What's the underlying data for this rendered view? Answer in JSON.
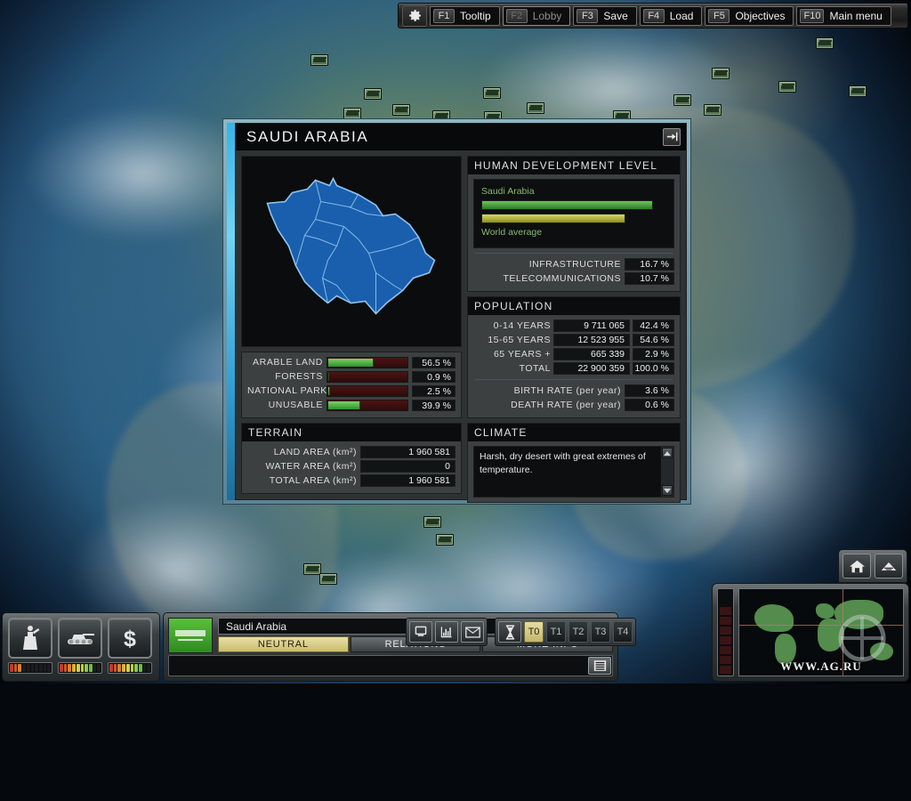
{
  "topbar": {
    "gear_icon": "gear-icon",
    "items": [
      {
        "key": "F1",
        "label": "Tooltip",
        "disabled": false
      },
      {
        "key": "F2",
        "label": "Lobby",
        "disabled": true
      },
      {
        "key": "F3",
        "label": "Save",
        "disabled": false
      },
      {
        "key": "F4",
        "label": "Load",
        "disabled": false
      },
      {
        "key": "F5",
        "label": "Objectives",
        "disabled": false
      },
      {
        "key": "F10",
        "label": "Main menu",
        "disabled": false
      }
    ]
  },
  "country_panel": {
    "title": "SAUDI ARABIA",
    "close_icon": "collapse-panel-icon",
    "land_use": {
      "rows": [
        {
          "label": "ARABLE LAND",
          "value": "56.5 %",
          "percent": 56.5
        },
        {
          "label": "FORESTS",
          "value": "0.9 %",
          "percent": 0.9
        },
        {
          "label": "NATIONAL PARKS",
          "value": "2.5 %",
          "percent": 2.5
        },
        {
          "label": "UNUSABLE",
          "value": "39.9 %",
          "percent": 39.9
        }
      ]
    },
    "terrain": {
      "title": "TERRAIN",
      "rows": [
        {
          "label": "LAND AREA (km²)",
          "value": "1 960 581"
        },
        {
          "label": "WATER AREA (km²)",
          "value": "0"
        },
        {
          "label": "TOTAL AREA (km²)",
          "value": "1 960 581"
        }
      ]
    },
    "hdl": {
      "title": "HUMAN DEVELOPMENT LEVEL",
      "country_label": "Saudi Arabia",
      "world_label": "World average",
      "country_percent": 93,
      "world_percent": 78,
      "stats": [
        {
          "label": "INFRASTRUCTURE",
          "value": "16.7 %"
        },
        {
          "label": "TELECOMMUNICATIONS",
          "value": "10.7 %"
        }
      ]
    },
    "population": {
      "title": "POPULATION",
      "rows": [
        {
          "label": "0-14 YEARS",
          "number": "9 711 065",
          "percent": "42.4 %"
        },
        {
          "label": "15-65 YEARS",
          "number": "12 523 955",
          "percent": "54.6 %"
        },
        {
          "label": "65 YEARS +",
          "number": "665 339",
          "percent": "2.9 %"
        },
        {
          "label": "TOTAL",
          "number": "22 900 359",
          "percent": "100.0 %"
        }
      ],
      "rates": [
        {
          "label": "BIRTH RATE (per year)",
          "value": "3.6 %"
        },
        {
          "label": "DEATH RATE (per year)",
          "value": "0.6 %"
        }
      ]
    },
    "climate": {
      "title": "CLIMATE",
      "text": "Harsh, dry desert with great extremes of temperature."
    }
  },
  "bottom_left": {
    "buttons": [
      {
        "name": "politics-button",
        "icon": "politician-podium-icon"
      },
      {
        "name": "military-button",
        "icon": "tank-icon"
      },
      {
        "name": "economy-button",
        "icon": "dollar-icon"
      }
    ],
    "meters": [
      {
        "name": "politics-meter",
        "lit": 3,
        "total": 10
      },
      {
        "name": "military-meter",
        "lit": 8,
        "total": 10
      },
      {
        "name": "economy-meter",
        "lit": 8,
        "total": 10
      }
    ]
  },
  "bottom_center": {
    "flag_icon": "saudi-arabia-flag",
    "country": "Saudi Arabia",
    "tabs": [
      {
        "label": "NEUTRAL",
        "active": true
      },
      {
        "label": "RELATIONS",
        "active": false
      },
      {
        "label": "MORE INFO",
        "active": false
      }
    ],
    "view_buttons": [
      {
        "name": "computer-view-button",
        "icon": "monitor-icon"
      },
      {
        "name": "statistics-button",
        "icon": "bar-chart-icon"
      },
      {
        "name": "messages-button",
        "icon": "envelope-icon"
      }
    ],
    "pause_icon": "hourglass-icon",
    "speeds": [
      {
        "label": "T0",
        "active": true
      },
      {
        "label": "T1",
        "active": false
      },
      {
        "label": "T2",
        "active": false
      },
      {
        "label": "T3",
        "active": false
      },
      {
        "label": "T4",
        "active": false
      }
    ],
    "message_log_icon": "message-log-icon"
  },
  "minimap": {
    "buttons": [
      {
        "name": "home-button",
        "icon": "home-icon"
      },
      {
        "name": "structures-button",
        "icon": "building-icon"
      }
    ],
    "watermark": "WWW.AG.RU",
    "zoom_segments": 7
  },
  "colors": {
    "accent_cyan": "#35b4e8",
    "bar_green": "#2f8f2c",
    "bar_track_red": "#4a1414",
    "hdl_world_yellow": "#8c8f22",
    "active_tab": "#c9bc6e"
  }
}
